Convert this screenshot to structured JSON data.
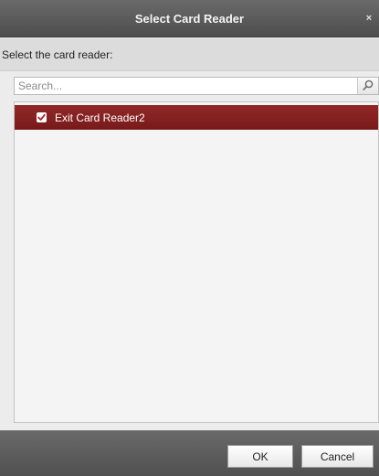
{
  "dialog": {
    "title": "Select Card Reader",
    "close_glyph": "×",
    "prompt": "Select the card reader:"
  },
  "search": {
    "placeholder": "Search...",
    "icon": "search-icon"
  },
  "readers": [
    {
      "label": "Exit Card Reader2",
      "checked": true,
      "selected": true
    }
  ],
  "buttons": {
    "ok": "OK",
    "cancel": "Cancel"
  },
  "colors": {
    "selected_row": "#862121",
    "title_bar": "#5a5a5a",
    "checkbox_mark": "#b32222"
  }
}
